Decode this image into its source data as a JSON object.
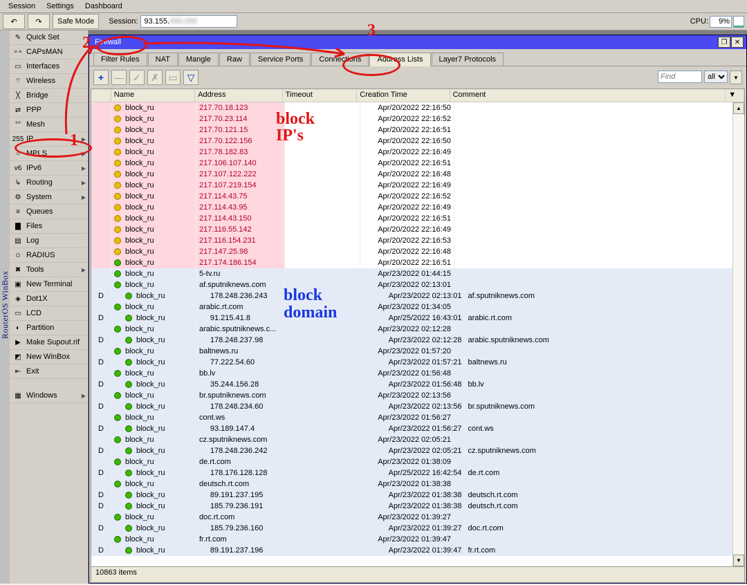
{
  "menubar": [
    "Session",
    "Settings",
    "Dashboard"
  ],
  "toolbar": {
    "safemode": "Safe Mode",
    "session_label": "Session:",
    "session_ip": "93.155.",
    "cpu_label": "CPU:",
    "cpu_val": "9%"
  },
  "vbar": "RouterOS WinBox",
  "sidebar": [
    {
      "label": "Quick Set",
      "ic": "✎",
      "arrow": false
    },
    {
      "label": "CAPsMAN",
      "ic": "∘∘",
      "arrow": false
    },
    {
      "label": "Interfaces",
      "ic": "▭",
      "arrow": false
    },
    {
      "label": "Wireless",
      "ic": "⌔",
      "arrow": false
    },
    {
      "label": "Bridge",
      "ic": "╳",
      "arrow": false
    },
    {
      "label": "PPP",
      "ic": "⇄",
      "arrow": false
    },
    {
      "label": "Mesh",
      "ic": "°°",
      "arrow": false
    },
    {
      "label": "IP",
      "ic": "255",
      "arrow": true
    },
    {
      "label": "MPLS",
      "ic": "○",
      "arrow": true
    },
    {
      "label": "IPv6",
      "ic": "v6",
      "arrow": true
    },
    {
      "label": "Routing",
      "ic": "↳",
      "arrow": true
    },
    {
      "label": "System",
      "ic": "⚙",
      "arrow": true
    },
    {
      "label": "Queues",
      "ic": "≡",
      "arrow": false
    },
    {
      "label": "Files",
      "ic": "▇",
      "arrow": false
    },
    {
      "label": "Log",
      "ic": "▤",
      "arrow": false
    },
    {
      "label": "RADIUS",
      "ic": "☺",
      "arrow": false
    },
    {
      "label": "Tools",
      "ic": "✖",
      "arrow": true
    },
    {
      "label": "New Terminal",
      "ic": "▣",
      "arrow": false
    },
    {
      "label": "Dot1X",
      "ic": "◈",
      "arrow": false
    },
    {
      "label": "LCD",
      "ic": "▭",
      "arrow": false
    },
    {
      "label": "Partition",
      "ic": "◐",
      "arrow": false
    },
    {
      "label": "Make Supout.rif",
      "ic": "▶",
      "arrow": false
    },
    {
      "label": "New WinBox",
      "ic": "◩",
      "arrow": false
    },
    {
      "label": "Exit",
      "ic": "⇤",
      "arrow": false
    },
    {
      "label": "",
      "ic": "",
      "arrow": false
    },
    {
      "label": "Windows",
      "ic": "▦",
      "arrow": true
    }
  ],
  "window": {
    "title": "Firewall",
    "tabs": [
      "Filter Rules",
      "NAT",
      "Mangle",
      "Raw",
      "Service Ports",
      "Connections",
      "Address Lists",
      "Layer7 Protocols"
    ],
    "active_tab": 6,
    "find_placeholder": "Find",
    "filter_sel": "all",
    "columns": [
      "Name",
      "Address",
      "Timeout",
      "Creation Time",
      "Comment"
    ],
    "status": "10863 items"
  },
  "rows": [
    {
      "flag": "",
      "b": "y",
      "n": "block_ru",
      "a": "217.70.18.123",
      "t": "Apr/20/2022 22:16:50",
      "c": "",
      "cls": "pinkbg",
      "ind": 0
    },
    {
      "flag": "",
      "b": "y",
      "n": "block_ru",
      "a": "217.70.23.114",
      "t": "Apr/20/2022 22:16:52",
      "c": "",
      "cls": "pinkbg",
      "ind": 0
    },
    {
      "flag": "",
      "b": "y",
      "n": "block_ru",
      "a": "217.70.121.15",
      "t": "Apr/20/2022 22:16:51",
      "c": "",
      "cls": "pinkbg",
      "ind": 0
    },
    {
      "flag": "",
      "b": "y",
      "n": "block_ru",
      "a": "217.70.122.156",
      "t": "Apr/20/2022 22:16:50",
      "c": "",
      "cls": "pinkbg",
      "ind": 0
    },
    {
      "flag": "",
      "b": "y",
      "n": "block_ru",
      "a": "217.78.182.83",
      "t": "Apr/20/2022 22:16:49",
      "c": "",
      "cls": "pinkbg",
      "ind": 0
    },
    {
      "flag": "",
      "b": "y",
      "n": "block_ru",
      "a": "217.106.107.140",
      "t": "Apr/20/2022 22:16:51",
      "c": "",
      "cls": "pinkbg",
      "ind": 0
    },
    {
      "flag": "",
      "b": "y",
      "n": "block_ru",
      "a": "217.107.122.222",
      "t": "Apr/20/2022 22:16:48",
      "c": "",
      "cls": "pinkbg",
      "ind": 0
    },
    {
      "flag": "",
      "b": "y",
      "n": "block_ru",
      "a": "217.107.219.154",
      "t": "Apr/20/2022 22:16:49",
      "c": "",
      "cls": "pinkbg",
      "ind": 0
    },
    {
      "flag": "",
      "b": "y",
      "n": "block_ru",
      "a": "217.114.43.75",
      "t": "Apr/20/2022 22:16:52",
      "c": "",
      "cls": "pinkbg",
      "ind": 0
    },
    {
      "flag": "",
      "b": "y",
      "n": "block_ru",
      "a": "217.114.43.95",
      "t": "Apr/20/2022 22:16:49",
      "c": "",
      "cls": "pinkbg",
      "ind": 0
    },
    {
      "flag": "",
      "b": "y",
      "n": "block_ru",
      "a": "217.114.43.150",
      "t": "Apr/20/2022 22:16:51",
      "c": "",
      "cls": "pinkbg",
      "ind": 0
    },
    {
      "flag": "",
      "b": "y",
      "n": "block_ru",
      "a": "217.116.55.142",
      "t": "Apr/20/2022 22:16:49",
      "c": "",
      "cls": "pinkbg",
      "ind": 0
    },
    {
      "flag": "",
      "b": "y",
      "n": "block_ru",
      "a": "217.116.154.231",
      "t": "Apr/20/2022 22:16:53",
      "c": "",
      "cls": "pinkbg",
      "ind": 0
    },
    {
      "flag": "",
      "b": "y",
      "n": "block_ru",
      "a": "217.147.25.98",
      "t": "Apr/20/2022 22:16:48",
      "c": "",
      "cls": "pinkbg",
      "ind": 0
    },
    {
      "flag": "",
      "b": "g",
      "n": "block_ru",
      "a": "217.174.186.154",
      "t": "Apr/20/2022 22:16:51",
      "c": "",
      "cls": "pinkbg",
      "ind": 0
    },
    {
      "flag": "",
      "b": "g",
      "n": "block_ru",
      "a": "5-tv.ru",
      "t": "Apr/23/2022 01:44:15",
      "c": "",
      "cls": "bluebg",
      "ind": 0
    },
    {
      "flag": "",
      "b": "g",
      "n": "block_ru",
      "a": "af.sputniknews.com",
      "t": "Apr/23/2022 02:13:01",
      "c": "",
      "cls": "bluebg",
      "ind": 0
    },
    {
      "flag": "D",
      "b": "g",
      "n": "block_ru",
      "a": "178.248.236.243",
      "t": "Apr/23/2022 02:13:01",
      "c": "af.sputniknews.com",
      "cls": "bluebg",
      "ind": 1
    },
    {
      "flag": "",
      "b": "g",
      "n": "block_ru",
      "a": "arabic.rt.com",
      "t": "Apr/23/2022 01:34:05",
      "c": "",
      "cls": "bluebg",
      "ind": 0
    },
    {
      "flag": "D",
      "b": "g",
      "n": "block_ru",
      "a": "91.215.41.8",
      "t": "Apr/25/2022 16:43:01",
      "c": "arabic.rt.com",
      "cls": "bluebg",
      "ind": 1
    },
    {
      "flag": "",
      "b": "g",
      "n": "block_ru",
      "a": "arabic.sputniknews.c...",
      "t": "Apr/23/2022 02:12:28",
      "c": "",
      "cls": "bluebg",
      "ind": 0
    },
    {
      "flag": "D",
      "b": "g",
      "n": "block_ru",
      "a": "178.248.237.98",
      "t": "Apr/23/2022 02:12:28",
      "c": "arabic.sputniknews.com",
      "cls": "bluebg",
      "ind": 1
    },
    {
      "flag": "",
      "b": "g",
      "n": "block_ru",
      "a": "baltnews.ru",
      "t": "Apr/23/2022 01:57:20",
      "c": "",
      "cls": "bluebg",
      "ind": 0
    },
    {
      "flag": "D",
      "b": "g",
      "n": "block_ru",
      "a": "77.222.54.60",
      "t": "Apr/23/2022 01:57:21",
      "c": "baltnews.ru",
      "cls": "bluebg",
      "ind": 1
    },
    {
      "flag": "",
      "b": "g",
      "n": "block_ru",
      "a": "bb.lv",
      "t": "Apr/23/2022 01:56:48",
      "c": "",
      "cls": "bluebg",
      "ind": 0
    },
    {
      "flag": "D",
      "b": "g",
      "n": "block_ru",
      "a": "35.244.156.28",
      "t": "Apr/23/2022 01:56:48",
      "c": "bb.lv",
      "cls": "bluebg",
      "ind": 1
    },
    {
      "flag": "",
      "b": "g",
      "n": "block_ru",
      "a": "br.sputniknews.com",
      "t": "Apr/23/2022 02:13:56",
      "c": "",
      "cls": "bluebg",
      "ind": 0
    },
    {
      "flag": "D",
      "b": "g",
      "n": "block_ru",
      "a": "178.248.234.60",
      "t": "Apr/23/2022 02:13:56",
      "c": "br.sputniknews.com",
      "cls": "bluebg",
      "ind": 1
    },
    {
      "flag": "",
      "b": "g",
      "n": "block_ru",
      "a": "cont.ws",
      "t": "Apr/23/2022 01:56:27",
      "c": "",
      "cls": "bluebg",
      "ind": 0
    },
    {
      "flag": "D",
      "b": "g",
      "n": "block_ru",
      "a": "93.189.147.4",
      "t": "Apr/23/2022 01:56:27",
      "c": "cont.ws",
      "cls": "bluebg",
      "ind": 1
    },
    {
      "flag": "",
      "b": "g",
      "n": "block_ru",
      "a": "cz.sputniknews.com",
      "t": "Apr/23/2022 02:05:21",
      "c": "",
      "cls": "bluebg",
      "ind": 0
    },
    {
      "flag": "D",
      "b": "g",
      "n": "block_ru",
      "a": "178.248.236.242",
      "t": "Apr/23/2022 02:05:21",
      "c": "cz.sputniknews.com",
      "cls": "bluebg",
      "ind": 1
    },
    {
      "flag": "",
      "b": "g",
      "n": "block_ru",
      "a": "de.rt.com",
      "t": "Apr/23/2022 01:38:09",
      "c": "",
      "cls": "bluebg",
      "ind": 0
    },
    {
      "flag": "D",
      "b": "g",
      "n": "block_ru",
      "a": "178.176.128.128",
      "t": "Apr/25/2022 16:42:54",
      "c": "de.rt.com",
      "cls": "bluebg",
      "ind": 1
    },
    {
      "flag": "",
      "b": "g",
      "n": "block_ru",
      "a": "deutsch.rt.com",
      "t": "Apr/23/2022 01:38:38",
      "c": "",
      "cls": "bluebg",
      "ind": 0
    },
    {
      "flag": "D",
      "b": "g",
      "n": "block_ru",
      "a": "89.191.237.195",
      "t": "Apr/23/2022 01:38:38",
      "c": "deutsch.rt.com",
      "cls": "bluebg",
      "ind": 1
    },
    {
      "flag": "D",
      "b": "g",
      "n": "block_ru",
      "a": "185.79.236.191",
      "t": "Apr/23/2022 01:38:38",
      "c": "deutsch.rt.com",
      "cls": "bluebg",
      "ind": 1
    },
    {
      "flag": "",
      "b": "g",
      "n": "block_ru",
      "a": "doc.rt.com",
      "t": "Apr/23/2022 01:39:27",
      "c": "",
      "cls": "bluebg",
      "ind": 0
    },
    {
      "flag": "D",
      "b": "g",
      "n": "block_ru",
      "a": "185.79.236.160",
      "t": "Apr/23/2022 01:39:27",
      "c": "doc.rt.com",
      "cls": "bluebg",
      "ind": 1
    },
    {
      "flag": "",
      "b": "g",
      "n": "block_ru",
      "a": "fr.rt.com",
      "t": "Apr/23/2022 01:39:47",
      "c": "",
      "cls": "bluebg",
      "ind": 0
    },
    {
      "flag": "D",
      "b": "g",
      "n": "block_ru",
      "a": "89.191.237.196",
      "t": "Apr/23/2022 01:39:47",
      "c": "fr.rt.com",
      "cls": "bluebg",
      "ind": 1
    }
  ],
  "annotations": {
    "one": "1",
    "two": "2",
    "three": "3",
    "blockip": "block IP's",
    "blockdom": "block domain"
  }
}
